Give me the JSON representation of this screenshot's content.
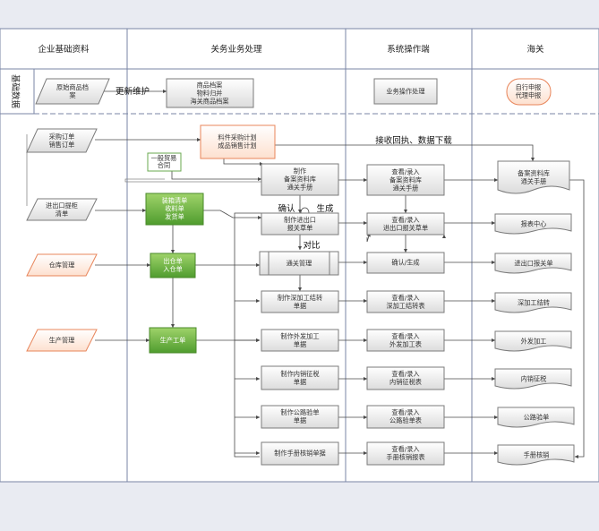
{
  "lanes": [
    {
      "id": "enterprise",
      "title": "企业基础资料"
    },
    {
      "id": "customs_biz",
      "title": "关务业务处理"
    },
    {
      "id": "system",
      "title": "系统操作端"
    },
    {
      "id": "customs",
      "title": "海关"
    }
  ],
  "side_label": "基础数据",
  "nodes": {
    "raw_goods_archive": [
      "原始商品档",
      "案"
    ],
    "goods_archive_group": [
      "商品档案",
      "物料归并",
      "海关商品档案"
    ],
    "biz_op": [
      "业务操作处理"
    ],
    "self_declare": [
      "自行申报",
      "代理申报"
    ],
    "purchase_sales_order": [
      "采购订单",
      "销售订单"
    ],
    "material_plan": [
      "料件采购计划",
      "成品销售计划"
    ],
    "general_trade": [
      "一般贸易",
      "合同"
    ],
    "make_record_manual": [
      "制作",
      "备案资料库",
      "通关手册"
    ],
    "review_record_manual": [
      "查看/录入",
      "备案资料库",
      "通关手册"
    ],
    "customs_record_manual": [
      "备案资料库",
      "通关手册"
    ],
    "io_shipping": [
      "进出口提柜",
      "清单"
    ],
    "packing_invoice": [
      "装箱清单",
      "收料单",
      "发货单"
    ],
    "make_io_declaration": [
      "制作进出口",
      "报关草单"
    ],
    "review_io_declaration": [
      "查看/录入",
      "进出口报关草单"
    ],
    "report_center": [
      "报表中心"
    ],
    "warehouse_mgmt": [
      "仓库管理"
    ],
    "out_in_stock": [
      "出仓单",
      "入仓单"
    ],
    "clearance_mgmt": [
      "通关管理"
    ],
    "confirm_generate": [
      "确认/生成"
    ],
    "io_declaration": [
      "进出口报关单"
    ],
    "make_deep_processing": [
      "制作深加工结转",
      "单据"
    ],
    "review_deep_processing": [
      "查看/录入",
      "深加工结转表"
    ],
    "deep_processing": [
      "深加工结转"
    ],
    "production_mgmt": [
      "生产管理"
    ],
    "production_order": [
      "生产工单"
    ],
    "make_outsourcing": [
      "制作外发加工",
      "单据"
    ],
    "review_outsourcing": [
      "查看/录入",
      "外发加工表"
    ],
    "outsourcing": [
      "外发加工"
    ],
    "make_domestic_tax": [
      "制作内销征税",
      "单据"
    ],
    "review_domestic_tax": [
      "查看/录入",
      "内销征税表"
    ],
    "domestic_tax": [
      "内销征税"
    ],
    "make_inspection": [
      "制作公路验单",
      "单据"
    ],
    "review_inspection": [
      "查看/录入",
      "公路验单表"
    ],
    "inspection": [
      "公路验单"
    ],
    "make_writeoff": [
      "制作手册核销单据"
    ],
    "review_writeoff": [
      "查看/录入",
      "手册核销报表"
    ],
    "writeoff": [
      "手册核销"
    ]
  },
  "edge_labels": {
    "update_maintain": "更新维护",
    "receive_download": "接收回执、数据下载",
    "confirm": "确认",
    "generate": "生成",
    "compare": "对比"
  }
}
